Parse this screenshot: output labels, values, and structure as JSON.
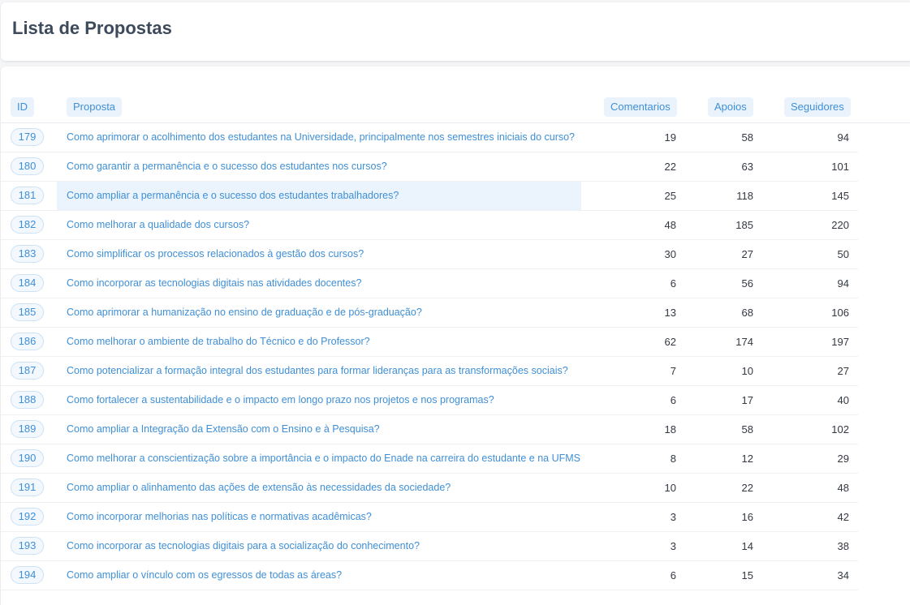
{
  "header": {
    "title": "Lista de Propostas"
  },
  "table": {
    "columns": {
      "id": "ID",
      "proposta": "Proposta",
      "comentarios": "Comentarios",
      "apoios": "Apoios",
      "seguidores": "Seguidores"
    },
    "rows": [
      {
        "id": "179",
        "title": "Como aprimorar o acolhimento dos estudantes na Universidade, principalmente nos semestres iniciais do curso?",
        "comentarios": "19",
        "apoios": "58",
        "seguidores": "94"
      },
      {
        "id": "180",
        "title": "Como garantir a permanência e o sucesso dos estudantes nos cursos?",
        "comentarios": "22",
        "apoios": "63",
        "seguidores": "101"
      },
      {
        "id": "181",
        "title": "Como ampliar a permanência e o sucesso dos estudantes trabalhadores?",
        "comentarios": "25",
        "apoios": "118",
        "seguidores": "145"
      },
      {
        "id": "182",
        "title": "Como melhorar a qualidade dos cursos?",
        "comentarios": "48",
        "apoios": "185",
        "seguidores": "220"
      },
      {
        "id": "183",
        "title": "Como simplificar os processos relacionados à gestão dos cursos?",
        "comentarios": "30",
        "apoios": "27",
        "seguidores": "50"
      },
      {
        "id": "184",
        "title": "Como incorporar as tecnologias digitais nas atividades docentes?",
        "comentarios": "6",
        "apoios": "56",
        "seguidores": "94"
      },
      {
        "id": "185",
        "title": "Como aprimorar a humanização no ensino de graduação e de pós-graduação?",
        "comentarios": "13",
        "apoios": "68",
        "seguidores": "106"
      },
      {
        "id": "186",
        "title": "Como melhorar o ambiente de trabalho do Técnico e do Professor?",
        "comentarios": "62",
        "apoios": "174",
        "seguidores": "197"
      },
      {
        "id": "187",
        "title": "Como potencializar a formação integral dos estudantes para formar lideranças para as transformações sociais?",
        "comentarios": "7",
        "apoios": "10",
        "seguidores": "27"
      },
      {
        "id": "188",
        "title": "Como fortalecer a sustentabilidade e o impacto em longo prazo nos projetos e nos programas?",
        "comentarios": "6",
        "apoios": "17",
        "seguidores": "40"
      },
      {
        "id": "189",
        "title": "Como ampliar a Integração da Extensão com o Ensino e à Pesquisa?",
        "comentarios": "18",
        "apoios": "58",
        "seguidores": "102"
      },
      {
        "id": "190",
        "title": "Como melhorar a conscientização sobre a importância e o impacto do Enade na carreira do estudante e na UFMS?",
        "comentarios": "8",
        "apoios": "12",
        "seguidores": "29"
      },
      {
        "id": "191",
        "title": "Como ampliar o alinhamento das ações de extensão às necessidades da sociedade?",
        "comentarios": "10",
        "apoios": "22",
        "seguidores": "48"
      },
      {
        "id": "192",
        "title": "Como incorporar melhorias nas políticas e normativas acadêmicas?",
        "comentarios": "3",
        "apoios": "16",
        "seguidores": "42"
      },
      {
        "id": "193",
        "title": "Como incorporar as tecnologias digitais para a socialização do conhecimento?",
        "comentarios": "3",
        "apoios": "14",
        "seguidores": "38"
      },
      {
        "id": "194",
        "title": "Como ampliar o vínculo com os egressos de todas as áreas?",
        "comentarios": "6",
        "apoios": "15",
        "seguidores": "34"
      }
    ]
  }
}
